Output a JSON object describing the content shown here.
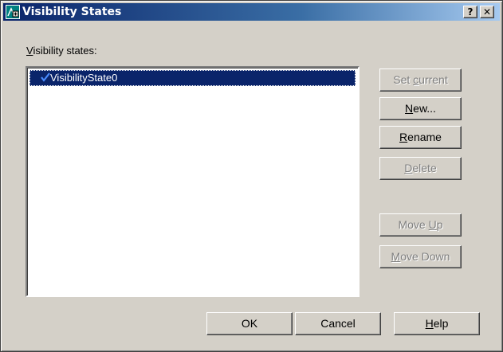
{
  "window": {
    "title": "Visibility States",
    "help_label": "?",
    "close_label": "✕"
  },
  "list": {
    "label_mnemonic": "V",
    "label_rest": "isibility states:",
    "items": [
      {
        "label": "VisibilityState0",
        "current": true,
        "selected": true
      }
    ]
  },
  "buttons": {
    "set_current": {
      "pre": "Set ",
      "mn": "c",
      "post": "urrent",
      "enabled": false
    },
    "new": {
      "pre": "",
      "mn": "N",
      "post": "ew...",
      "enabled": true
    },
    "rename": {
      "pre": "",
      "mn": "R",
      "post": "ename",
      "enabled": true
    },
    "delete": {
      "pre": "",
      "mn": "D",
      "post": "elete",
      "enabled": false
    },
    "move_up": {
      "pre": "Move ",
      "mn": "U",
      "post": "p",
      "enabled": false
    },
    "move_down": {
      "pre": "",
      "mn": "M",
      "post": "ove Down",
      "enabled": false
    },
    "ok": {
      "label": "OK"
    },
    "cancel": {
      "label": "Cancel"
    },
    "help": {
      "pre": "",
      "mn": "H",
      "post": "elp"
    }
  },
  "icons": {
    "app": "block-editor-icon",
    "current_state": "checkmark-icon"
  },
  "colors": {
    "face": "#d4d0c8",
    "selection": "#0a246a",
    "title_start": "#0a246a",
    "title_end": "#a6caf0",
    "disabled_text": "#808080",
    "check_blue": "#1b5fd6"
  }
}
